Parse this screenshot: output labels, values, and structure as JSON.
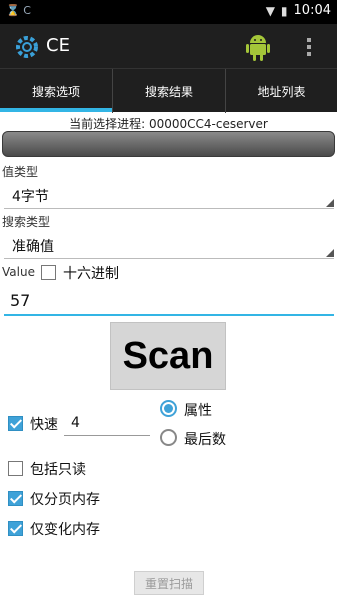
{
  "status_bar": {
    "left_text": "⌛ C",
    "time": "10:04",
    "battery_icon": "battery-icon",
    "signal_icon": "signal-icon"
  },
  "action_bar": {
    "title": "CE",
    "app_icon": "gear-icon",
    "android_icon": "android-icon",
    "overflow_icon": "overflow-menu-icon"
  },
  "tabs": [
    {
      "label": "搜索选项",
      "active": true
    },
    {
      "label": "搜索结果",
      "active": false
    },
    {
      "label": "地址列表",
      "active": false
    }
  ],
  "process": {
    "label": "当前选择进程: 00000CC4-ceserver"
  },
  "value_type": {
    "label": "值类型",
    "selected": "4字节"
  },
  "search_type": {
    "label": "搜索类型",
    "selected": "准确值"
  },
  "value": {
    "label": "Value",
    "hex_label": "十六进制",
    "hex_checked": false,
    "input": "57"
  },
  "scan": {
    "label": "Scan"
  },
  "fast": {
    "label": "快速",
    "checked": true,
    "input": "4"
  },
  "radio_options": [
    {
      "label": "属性",
      "selected": true
    },
    {
      "label": "最后数",
      "selected": false
    }
  ],
  "options": [
    {
      "label": "包括只读",
      "checked": false
    },
    {
      "label": "仅分页内存",
      "checked": true
    },
    {
      "label": "仅变化内存",
      "checked": true
    }
  ],
  "reset": {
    "label": "重置扫描"
  },
  "colors": {
    "accent": "#33b5e5",
    "bar": "#1f1f1f",
    "check": "#3fa2d8"
  }
}
